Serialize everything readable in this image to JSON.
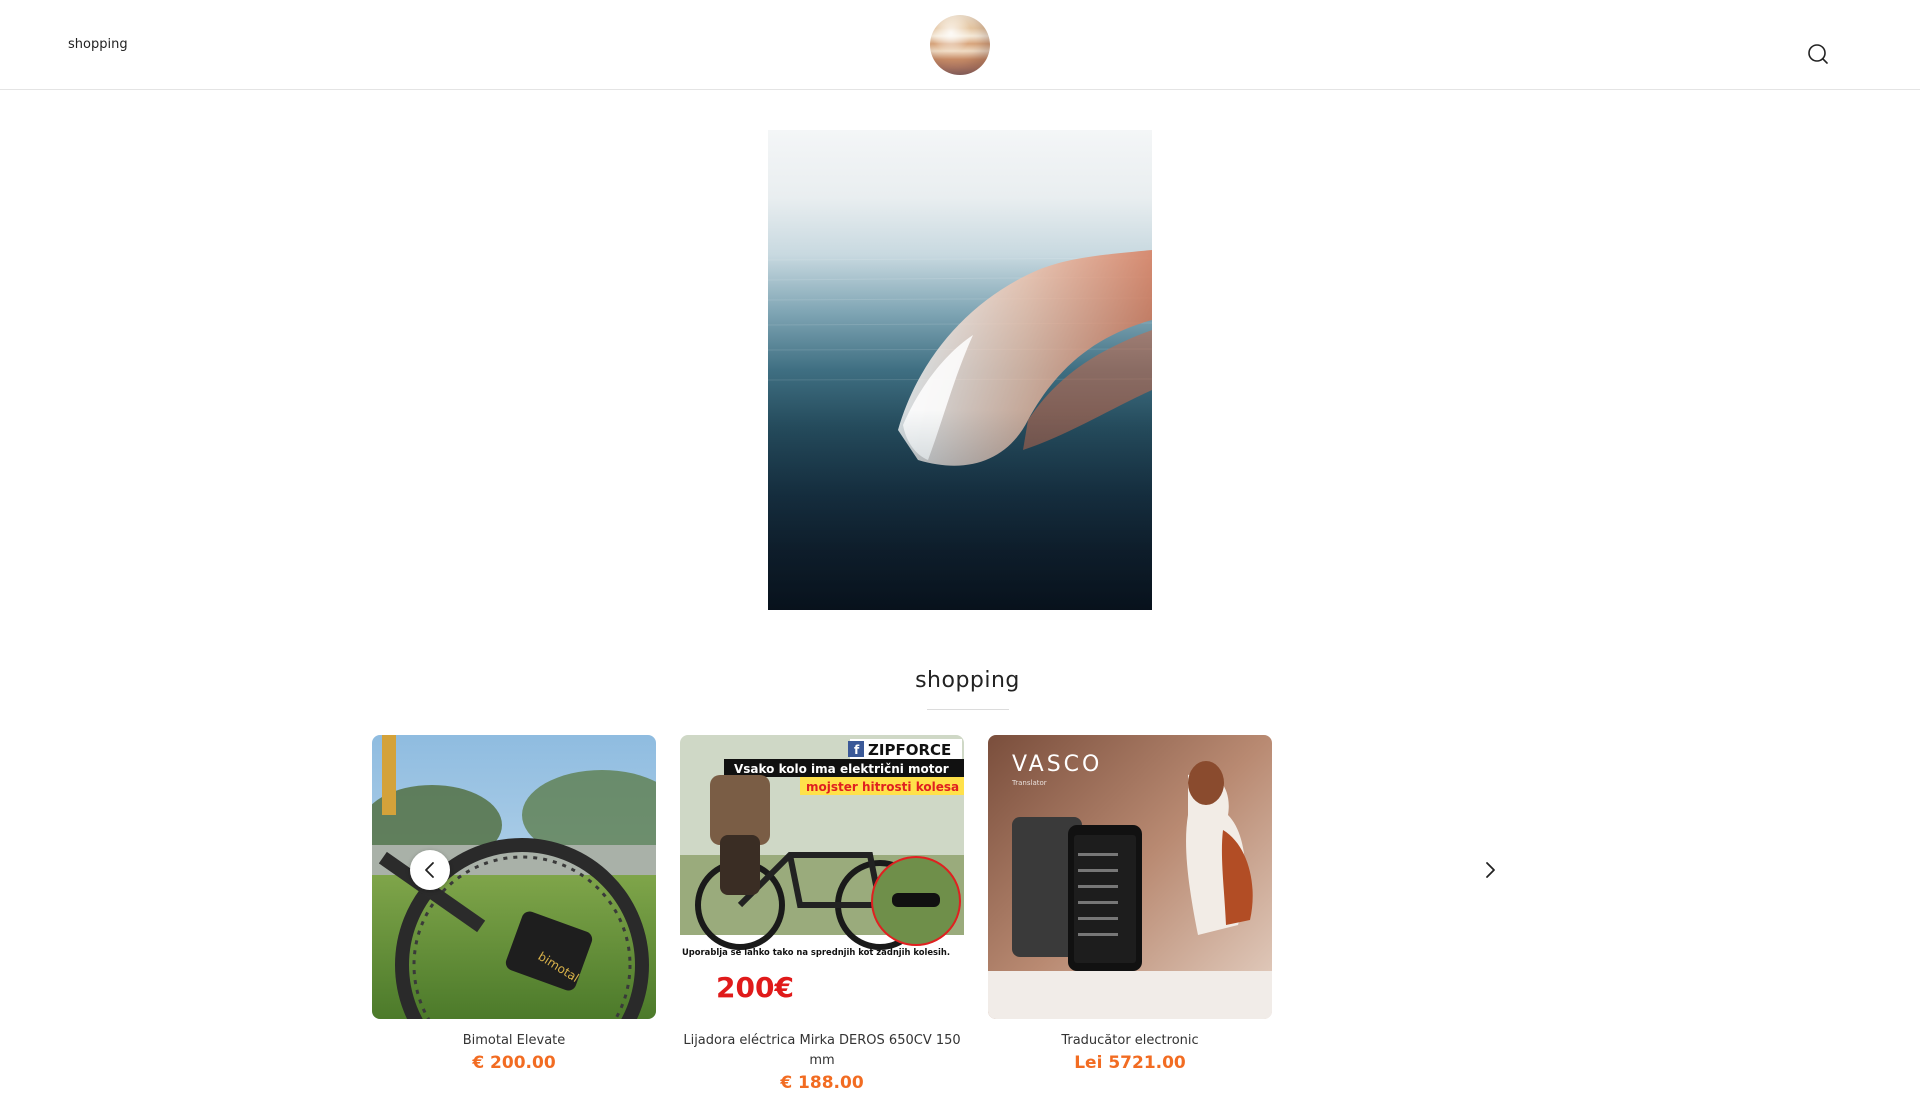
{
  "header": {
    "nav_link": "shopping",
    "logo_icon": "planet-logo-icon",
    "search_icon": "search-icon"
  },
  "hero": {
    "image": "ocean-wave-photo"
  },
  "section": {
    "title": "shopping"
  },
  "carousel": {
    "prev_icon": "chevron-left-icon",
    "next_icon": "chevron-right-icon",
    "products": [
      {
        "name": "Bimotal Elevate",
        "price": "€ 200.00",
        "image_text": "bimotal"
      },
      {
        "name": "Lijadora eléctrica Mirka DEROS 650CV 150 mm",
        "price": "€ 188.00",
        "image_text": {
          "brand": "ZIPFORCE",
          "banner": "Vsako kolo ima električni motor",
          "sub": "mojster hitrosti kolesa",
          "note": "Uporablja se lahko tako na sprednjih kot zadnjih kolesih.",
          "price": "200€"
        }
      },
      {
        "name": "Traducător electronic",
        "price": "Lei 5721.00",
        "image_text": {
          "brand": "VASCO",
          "sub": "Translator"
        }
      }
    ]
  },
  "colors": {
    "price": "#f26c22",
    "border": "#e4e4e4",
    "text": "#222222"
  }
}
